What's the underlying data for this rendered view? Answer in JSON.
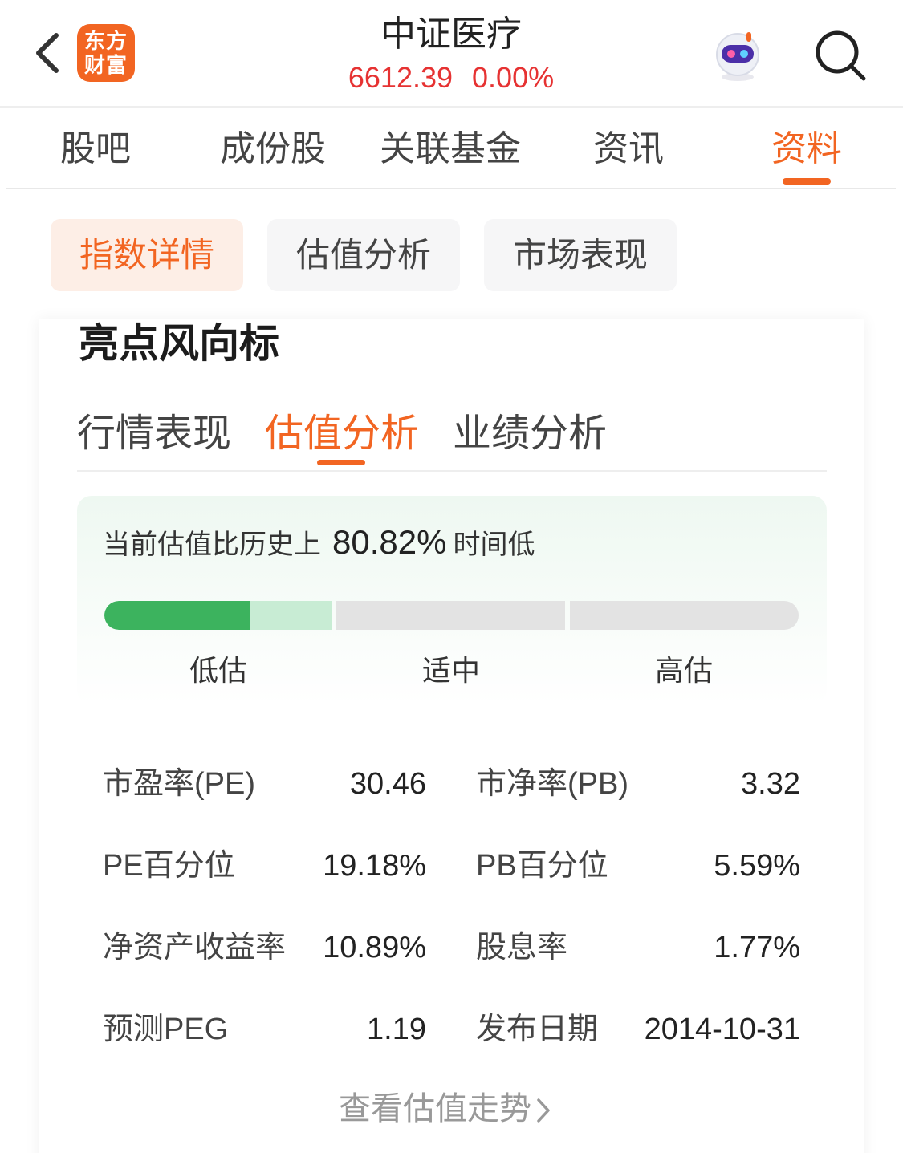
{
  "header": {
    "logo_line1": "东方",
    "logo_line2": "财富",
    "title": "中证医疗",
    "price": "6612.39",
    "change_pct": "0.00%"
  },
  "main_tabs": [
    {
      "label": "股吧"
    },
    {
      "label": "成份股"
    },
    {
      "label": "关联基金"
    },
    {
      "label": "资讯"
    },
    {
      "label": "资料",
      "active": true
    }
  ],
  "sub_tabs": [
    {
      "label": "指数详情",
      "active": true
    },
    {
      "label": "估值分析"
    },
    {
      "label": "市场表现"
    }
  ],
  "card": {
    "title": "亮点风向标",
    "tabs": [
      {
        "label": "行情表现"
      },
      {
        "label": "估值分析",
        "active": true
      },
      {
        "label": "业绩分析"
      }
    ],
    "valuation": {
      "prefix": "当前估值比历史上",
      "percent": "80.82%",
      "suffix": "时间低",
      "level_in_low_zone": 0.64,
      "zones": [
        "低估",
        "适中",
        "高估"
      ]
    },
    "metrics": [
      {
        "label": "市盈率(PE)",
        "value": "30.46"
      },
      {
        "label": "市净率(PB)",
        "value": "3.32"
      },
      {
        "label": "PE百分位",
        "value": "19.18%"
      },
      {
        "label": "PB百分位",
        "value": "5.59%"
      },
      {
        "label": "净资产收益率",
        "value": "10.89%"
      },
      {
        "label": "股息率",
        "value": "1.77%"
      },
      {
        "label": "预测PEG",
        "value": "1.19"
      },
      {
        "label": "发布日期",
        "value": "2014-10-31"
      }
    ],
    "trend_link": "查看估值走势"
  },
  "colors": {
    "accent": "#f26522",
    "price_red": "#e63232",
    "low_green": "#3cb35e",
    "low_green_light": "#c8ecd4"
  },
  "icons": {
    "back": "chevron-left",
    "assistant": "robot",
    "search": "magnifier",
    "trend": "chevron-right"
  }
}
